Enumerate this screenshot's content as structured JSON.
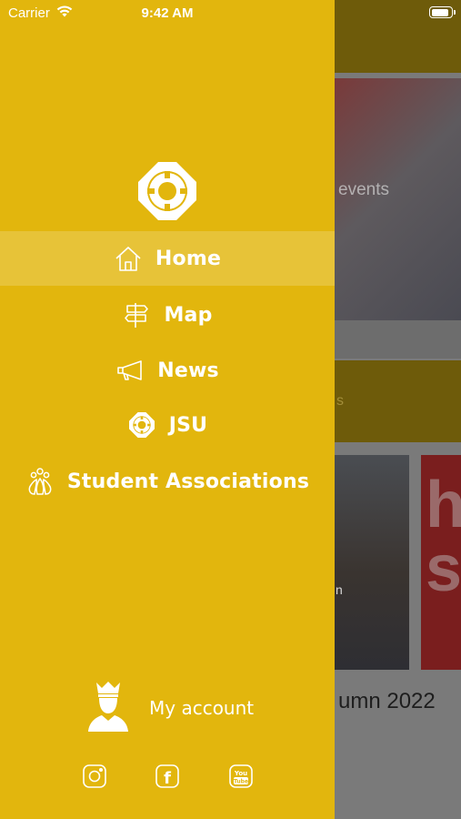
{
  "status_bar": {
    "carrier": "Carrier",
    "time": "9:42 AM",
    "battery_level": 0.9
  },
  "background": {
    "hero_text": "events",
    "band_text": "s",
    "card_text": "n",
    "card_logo": "h s",
    "caption": "umn 2022"
  },
  "drawer": {
    "logo_icon": "jsu-logo-icon",
    "menu": [
      {
        "label": "Home",
        "icon": "home-icon",
        "active": true
      },
      {
        "label": "Map",
        "icon": "signpost-icon",
        "active": false
      },
      {
        "label": "News",
        "icon": "megaphone-icon",
        "active": false
      },
      {
        "label": "JSU",
        "icon": "jsu-logo-icon",
        "active": false
      },
      {
        "label": "Student Associations",
        "icon": "paw-icon",
        "active": false
      }
    ],
    "account": {
      "label": "My account",
      "icon": "crowned-avatar-icon"
    },
    "social": [
      {
        "icon": "instagram-icon"
      },
      {
        "icon": "facebook-icon",
        "glyph": "f"
      },
      {
        "icon": "youtube-icon",
        "glyph": "You Tube"
      }
    ],
    "colors": {
      "drawer_bg": "#e2b60d",
      "text": "#ffffff"
    }
  }
}
